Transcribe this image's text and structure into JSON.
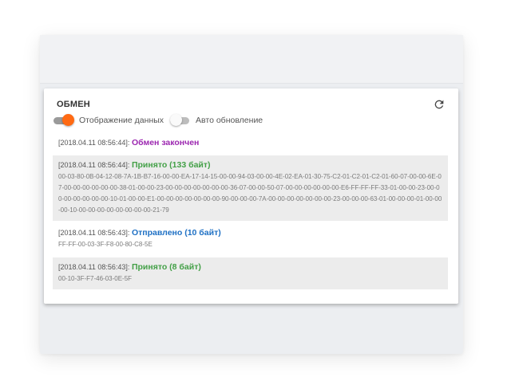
{
  "panel": {
    "title": "ОБМЕН",
    "toggles": [
      {
        "label": "Отображение данных",
        "on": true
      },
      {
        "label": "Авто обновление",
        "on": false
      }
    ]
  },
  "colors": {
    "toggle_on": "#ff6a13",
    "finished": "#9c27b0",
    "received": "#43a047",
    "sent": "#1e70c4"
  },
  "log": [
    {
      "time": "[2018.04.11 08:56:44]:",
      "message": "Обмен закончен",
      "kind": "finished",
      "payload": ""
    },
    {
      "time": "[2018.04.11 08:56:44]:",
      "message": "Принято (133 байт)",
      "kind": "received",
      "payload": "00-03-80-0B-04-12-08-7A-1B-B7-16-00-00-EA-17-14-15-00-00-94-03-00-00-4E-02-EA-01-30-75-C2-01-C2-01-C2-01-60-07-00-00-6E-07-00-00-00-00-00-00-38-01-00-00-23-00-00-00-00-00-00-00-36-07-00-00-50-07-00-00-00-00-00-00-E6-FF-FF-FF-33-01-00-00-23-00-00-00-00-00-00-00-10-01-00-00-E1-00-00-00-00-00-00-00-90-00-00-00-7A-00-00-00-00-00-00-00-23-00-00-00-63-01-00-00-00-01-00-00-00-10-00-00-00-00-00-00-00-00-21-79"
    },
    {
      "time": "[2018.04.11 08:56:43]:",
      "message": "Отправлено (10 байт)",
      "kind": "sent",
      "payload": "FF-FF-00-03-3F-F8-00-80-C8-5E"
    },
    {
      "time": "[2018.04.11 08:56:43]:",
      "message": "Принято (8 байт)",
      "kind": "received",
      "payload": "00-10-3F-F7-46-03-0E-5F"
    }
  ],
  "icons": {
    "refresh": "refresh-icon"
  }
}
